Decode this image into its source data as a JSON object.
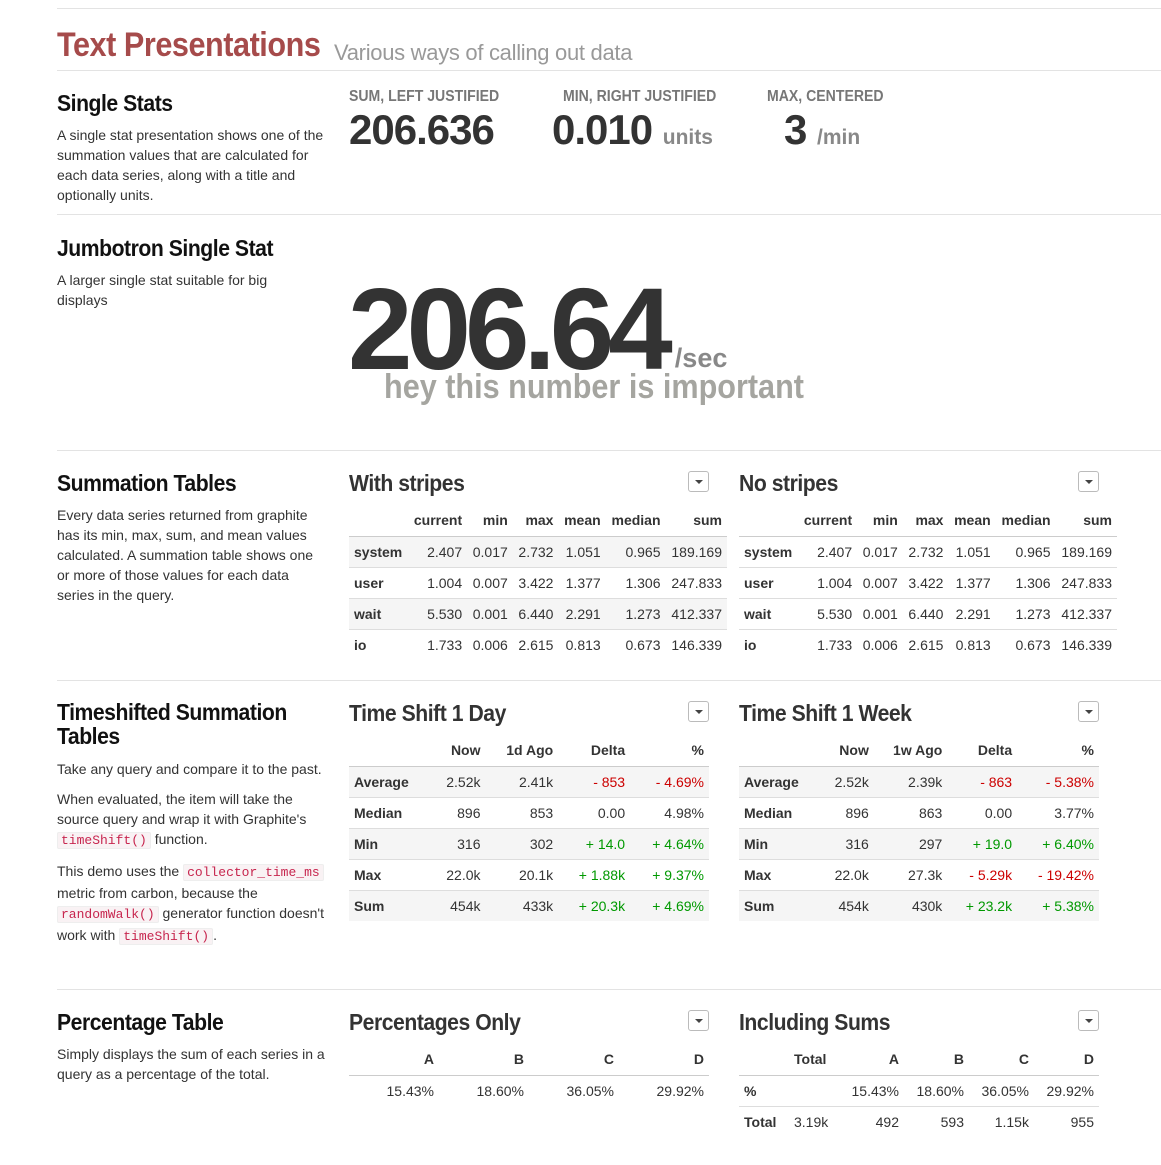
{
  "header": {
    "title": "Text Presentations",
    "subtitle": "Various ways of calling out data"
  },
  "single_stats": {
    "title": "Single Stats",
    "description": "A single stat presentation shows one of the summation values that are calculated for each data series, along with a title and optionally units.",
    "stats": [
      {
        "label": "SUM, LEFT JUSTIFIED",
        "value": "206.636",
        "units": ""
      },
      {
        "label": "MIN, RIGHT JUSTIFIED",
        "value": "0.010",
        "units": "units"
      },
      {
        "label": "MAX, CENTERED",
        "value": "3",
        "units": "/min"
      }
    ]
  },
  "jumbotron": {
    "title": "Jumbotron Single Stat",
    "description": "A larger single stat suitable for big displays",
    "value": "206.64",
    "units": "/sec",
    "caption": "hey this number is important"
  },
  "summation": {
    "title": "Summation Tables",
    "description": "Every data series returned from graphite has its min, max, sum, and mean values calculated. A summation table shows one or more of those values for each data series in the query.",
    "columns": [
      "",
      "current",
      "min",
      "max",
      "mean",
      "median",
      "sum"
    ],
    "rows": [
      [
        "system",
        "2.407",
        "0.017",
        "2.732",
        "1.051",
        "0.965",
        "189.169"
      ],
      [
        "user",
        "1.004",
        "0.007",
        "3.422",
        "1.377",
        "1.306",
        "247.833"
      ],
      [
        "wait",
        "5.530",
        "0.001",
        "6.440",
        "2.291",
        "1.273",
        "412.337"
      ],
      [
        "io",
        "1.733",
        "0.006",
        "2.615",
        "0.813",
        "0.673",
        "146.339"
      ]
    ],
    "striped_title": "With stripes",
    "plain_title": "No stripes"
  },
  "timeshift": {
    "title": "Timeshifted Summation Tables",
    "desc_1": "Take any query and compare it to the past.",
    "desc_2a": "When evaluated, the item will take the source query and wrap it with Graphite's ",
    "desc_2_code": "timeShift()",
    "desc_2b": " function.",
    "desc_3a": "This demo uses the ",
    "desc_3_code1": "collector_time_ms",
    "desc_3b": " metric from carbon, because the ",
    "desc_3_code2": "randomWalk()",
    "desc_3c": " generator function doesn't work with ",
    "desc_3_code3": "timeShift()",
    "desc_3d": ".",
    "day": {
      "title": "Time Shift 1 Day",
      "columns": [
        "",
        "Now",
        "1d Ago",
        "Delta",
        "%"
      ],
      "rows": [
        [
          "Average",
          "2.52k",
          "2.41k",
          "- 853",
          "- 4.69%"
        ],
        [
          "Median",
          "896",
          "853",
          "0.00",
          "4.98%"
        ],
        [
          "Min",
          "316",
          "302",
          "+ 14.0",
          "+ 4.64%"
        ],
        [
          "Max",
          "22.0k",
          "20.1k",
          "+ 1.88k",
          "+ 9.37%"
        ],
        [
          "Sum",
          "454k",
          "433k",
          "+ 20.3k",
          "+ 4.69%"
        ]
      ],
      "signs": [
        [
          "neg",
          "neg"
        ],
        [
          "",
          ""
        ],
        [
          "pos",
          "pos"
        ],
        [
          "pos",
          "pos"
        ],
        [
          "pos",
          "pos"
        ]
      ]
    },
    "week": {
      "title": "Time Shift 1 Week",
      "columns": [
        "",
        "Now",
        "1w Ago",
        "Delta",
        "%"
      ],
      "rows": [
        [
          "Average",
          "2.52k",
          "2.39k",
          "- 863",
          "- 5.38%"
        ],
        [
          "Median",
          "896",
          "863",
          "0.00",
          "3.77%"
        ],
        [
          "Min",
          "316",
          "297",
          "+ 19.0",
          "+ 6.40%"
        ],
        [
          "Max",
          "22.0k",
          "27.3k",
          "- 5.29k",
          "- 19.42%"
        ],
        [
          "Sum",
          "454k",
          "430k",
          "+ 23.2k",
          "+ 5.38%"
        ]
      ],
      "signs": [
        [
          "neg",
          "neg"
        ],
        [
          "",
          ""
        ],
        [
          "pos",
          "pos"
        ],
        [
          "neg",
          "neg"
        ],
        [
          "pos",
          "pos"
        ]
      ]
    }
  },
  "percentage": {
    "title": "Percentage Table",
    "description": "Simply displays the sum of each series in a query as a percentage of the total.",
    "only": {
      "title": "Percentages Only",
      "columns": [
        "A",
        "B",
        "C",
        "D"
      ],
      "values": [
        "15.43%",
        "18.60%",
        "36.05%",
        "29.92%"
      ]
    },
    "sums": {
      "title": "Including Sums",
      "columns": [
        "",
        "Total",
        "A",
        "B",
        "C",
        "D"
      ],
      "rows": [
        [
          "%",
          "",
          "15.43%",
          "18.60%",
          "36.05%",
          "29.92%"
        ],
        [
          "Total",
          "3.19k",
          "492",
          "593",
          "1.15k",
          "955"
        ]
      ]
    }
  }
}
